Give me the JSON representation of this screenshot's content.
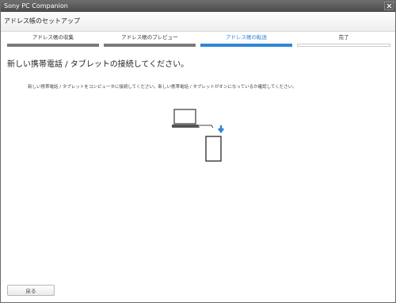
{
  "window": {
    "title": "Sony PC Companion"
  },
  "header": {
    "title": "アドレス帳のセットアップ"
  },
  "steps": [
    {
      "label": "アドレス帳の収集",
      "state": "done"
    },
    {
      "label": "アドレス帳のプレビュー",
      "state": "done"
    },
    {
      "label": "アドレス帳の転送",
      "state": "active"
    },
    {
      "label": "完了",
      "state": "upcoming"
    }
  ],
  "main": {
    "heading": "新しい携帯電話 / タブレットの接続してください。",
    "instruction": "新しい携帯電話 / タブレットをコンピュータに接続してください。新しい携帯電話 / タブレットがオンになっているか確認してください。"
  },
  "footer": {
    "back_label": "戻る"
  },
  "icons": {
    "close": "close-icon",
    "laptop": "laptop-icon",
    "phone": "phone-icon",
    "arrow": "arrow-down-icon"
  },
  "colors": {
    "accent": "#2f86d8",
    "titlebar": "#555555",
    "done_bar": "#7a7a7a"
  }
}
